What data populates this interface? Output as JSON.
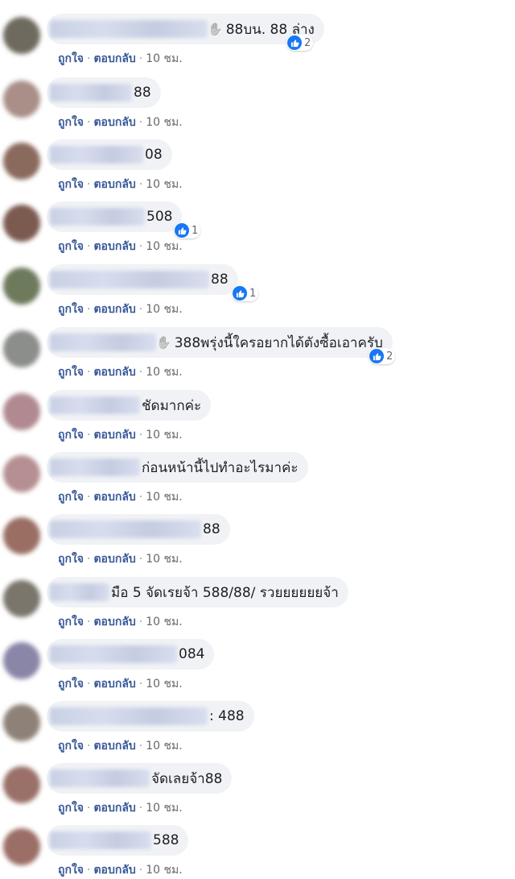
{
  "comments": [
    {
      "text": "88บน. 88 ล่าง",
      "hand": true,
      "likes": "2",
      "avatar_color": "#6f6a5e",
      "like": "ถูกใจ",
      "reply": "ตอบกลับ",
      "time": "10 ชม."
    },
    {
      "text": "88",
      "hand": false,
      "likes": "",
      "avatar_color": "#a98f88",
      "like": "ถูกใจ",
      "reply": "ตอบกลับ",
      "time": "10 ชม."
    },
    {
      "text": "08",
      "hand": false,
      "likes": "",
      "avatar_color": "#8a6a5c",
      "like": "ถูกใจ",
      "reply": "ตอบกลับ",
      "time": "10 ชม."
    },
    {
      "text": "508",
      "hand": false,
      "likes": "1",
      "avatar_color": "#7b5a50",
      "like": "ถูกใจ",
      "reply": "ตอบกลับ",
      "time": "10 ชม."
    },
    {
      "text": "88",
      "hand": false,
      "likes": "1",
      "avatar_color": "#6e7a5c",
      "like": "ถูกใจ",
      "reply": "ตอบกลับ",
      "time": "10 ชม."
    },
    {
      "text": "388พรุ่งนี้ใครอยากได้ตังซื้อเอาครับ",
      "hand": true,
      "likes": "2",
      "avatar_color": "#8b8e8a",
      "like": "ถูกใจ",
      "reply": "ตอบกลับ",
      "time": "10 ชม."
    },
    {
      "text": "ชัดมากค่ะ",
      "hand": false,
      "likes": "",
      "avatar_color": "#b08a90",
      "like": "ถูกใจ",
      "reply": "ตอบกลับ",
      "time": "10 ชม."
    },
    {
      "text": "ก่อนหน้านี้ไปทำอะไรมาค่ะ",
      "hand": false,
      "likes": "",
      "avatar_color": "#b58f92",
      "like": "ถูกใจ",
      "reply": "ตอบกลับ",
      "time": "10 ชม."
    },
    {
      "text": "88",
      "hand": false,
      "likes": "",
      "avatar_color": "#9a6e62",
      "like": "ถูกใจ",
      "reply": "ตอบกลับ",
      "time": "10 ชม."
    },
    {
      "text": "มือ 5 จัดเรยจ้า 588/88/ รวยยยยยยจ้า",
      "hand": false,
      "likes": "",
      "avatar_color": "#7a766c",
      "like": "ถูกใจ",
      "reply": "ตอบกลับ",
      "time": "10 ชม."
    },
    {
      "text": "084",
      "hand": false,
      "likes": "",
      "avatar_color": "#8a86a8",
      "like": "ถูกใจ",
      "reply": "ตอบกลับ",
      "time": "10 ชม."
    },
    {
      "text": ": 488",
      "hand": false,
      "likes": "",
      "avatar_color": "#8e8278",
      "like": "ถูกใจ",
      "reply": "ตอบกลับ",
      "time": "10 ชม."
    },
    {
      "text": "จัดเลยจ้า88",
      "hand": false,
      "likes": "",
      "avatar_color": "#9a7068",
      "like": "ถูกใจ",
      "reply": "ตอบกลับ",
      "time": "10 ชม."
    },
    {
      "text": "588",
      "hand": false,
      "likes": "",
      "avatar_color": "#9b6e66",
      "like": "ถูกใจ",
      "reply": "ตอบกลับ",
      "time": "10 ชม."
    }
  ]
}
